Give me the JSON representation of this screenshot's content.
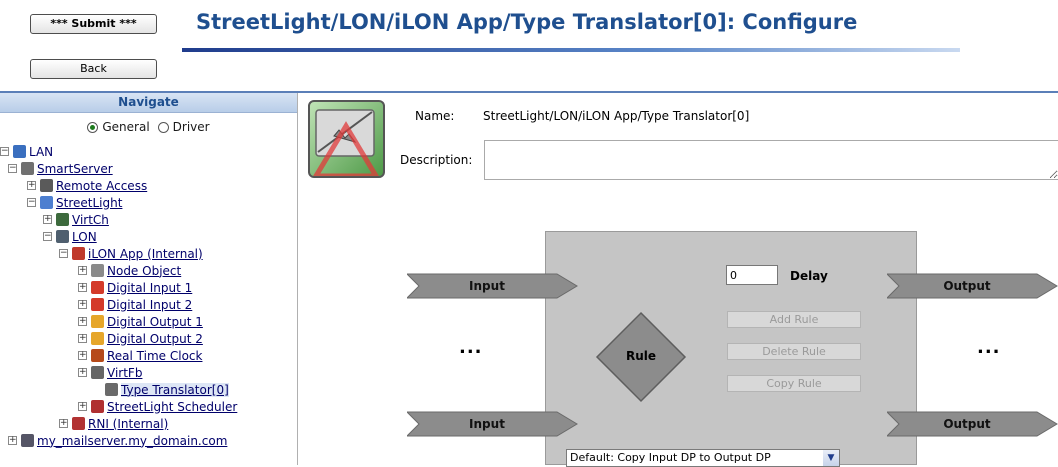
{
  "header": {
    "submit_label": "*** Submit ***",
    "back_label": "Back",
    "title": "StreetLight/LON/iLON App/Type Translator[0]: Configure"
  },
  "nav": {
    "title": "Navigate",
    "mode_general": "General",
    "mode_driver": "Driver",
    "mode_selected": "General",
    "tree": [
      {
        "label": "LAN",
        "exp": "⊟",
        "icon": "network-icon"
      },
      {
        "label": "SmartServer",
        "exp": "⊟",
        "icon": "server-icon"
      },
      {
        "label": "Remote Access",
        "exp": "⊞",
        "icon": "remote-access-icon"
      },
      {
        "label": "StreetLight",
        "exp": "⊟",
        "icon": "network-channel-icon"
      },
      {
        "label": "VirtCh",
        "exp": "⊞",
        "icon": "virtual-channel-icon"
      },
      {
        "label": "LON",
        "exp": "⊟",
        "icon": "lon-icon"
      },
      {
        "label": "iLON App (Internal)",
        "exp": "⊟",
        "icon": "ilon-app-icon"
      },
      {
        "label": "Node Object",
        "exp": "⊞",
        "icon": "node-object-icon"
      },
      {
        "label": "Digital Input 1",
        "exp": "⊞",
        "icon": "digital-input-icon"
      },
      {
        "label": "Digital Input 2",
        "exp": "⊞",
        "icon": "digital-input-icon"
      },
      {
        "label": "Digital Output 1",
        "exp": "⊞",
        "icon": "digital-output-icon"
      },
      {
        "label": "Digital Output 2",
        "exp": "⊞",
        "icon": "digital-output-icon"
      },
      {
        "label": "Real Time Clock",
        "exp": "⊞",
        "icon": "clock-icon"
      },
      {
        "label": "VirtFb",
        "exp": "⊞",
        "icon": "virtual-fb-icon"
      },
      {
        "label": "Type Translator[0]",
        "exp": "",
        "icon": "type-translator-icon"
      },
      {
        "label": "StreetLight Scheduler",
        "exp": "⊞",
        "icon": "scheduler-icon"
      },
      {
        "label": "RNI (Internal)",
        "exp": "⊞",
        "icon": "rni-icon"
      },
      {
        "label": "my_mailserver.my_domain.com",
        "exp": "⊞",
        "icon": "mail-server-icon"
      }
    ]
  },
  "main": {
    "name_label": "Name:",
    "name_value": "StreetLight/LON/iLON App/Type Translator[0]",
    "description_label": "Description:",
    "description_value": "",
    "input_label": "Input",
    "output_label": "Output",
    "dots": "...",
    "rule_label": "Rule",
    "delay_value": "0",
    "delay_label": "Delay",
    "add_rule": "Add Rule",
    "delete_rule": "Delete Rule",
    "copy_rule": "Copy Rule",
    "default_select": "Default: Copy Input DP to Output DP"
  },
  "colors": {
    "title": "#1f4f8f",
    "tree_link": "#00006a",
    "rule_panel": "#c5c5c5",
    "arrow": "#8c8c8c"
  }
}
